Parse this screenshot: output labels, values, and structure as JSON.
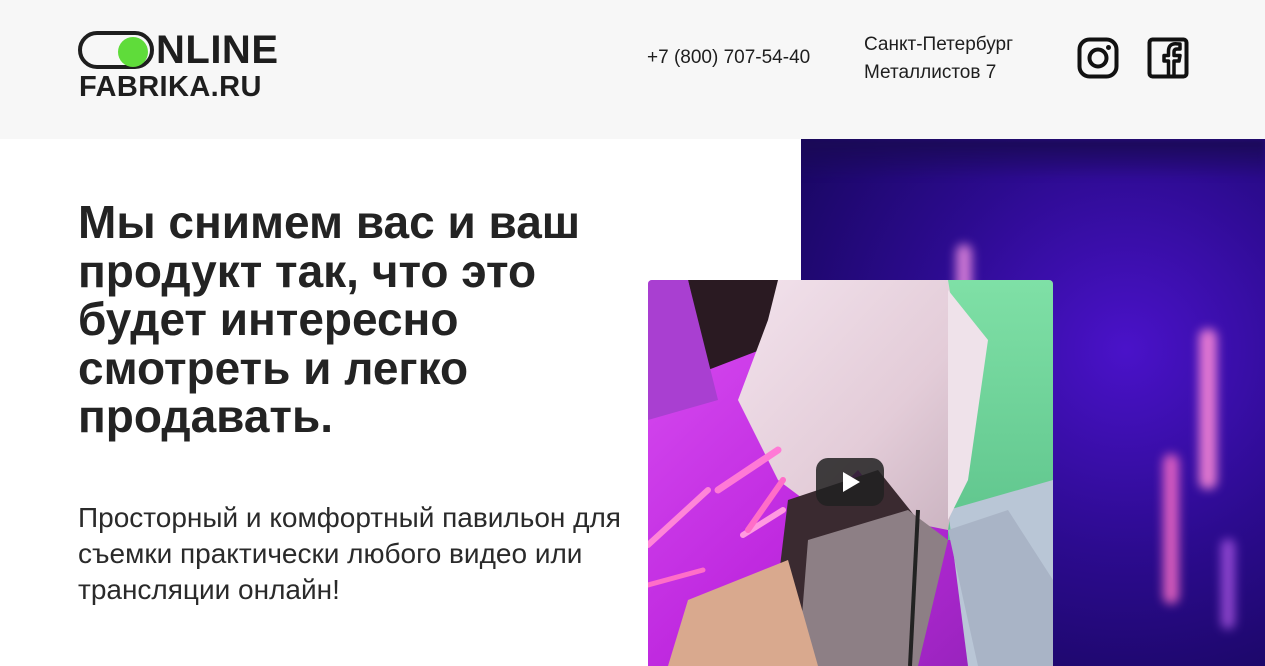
{
  "header": {
    "logo": {
      "line1": "NLINE",
      "line2": "FABRIKA.RU",
      "toggle_color": "#5fdc3a"
    },
    "phone": "+7 (800) 707-54-40",
    "address": {
      "city": "Санкт-Петербург",
      "street": "Металлистов 7"
    },
    "social": [
      {
        "icon": "instagram-icon"
      },
      {
        "icon": "facebook-icon"
      }
    ]
  },
  "hero": {
    "title": "Мы снимем вас и ваш продукт так, что это будет интересно смотреть и легко продавать.",
    "subtitle": "Просторный и комфортный павильон для съемки практически любого видео или трансляции онлайн!"
  },
  "video": {
    "play_icon": "play-icon"
  },
  "colors": {
    "header_bg": "#f7f7f7",
    "text": "#232323",
    "accent_green": "#5fdc3a",
    "bg_purple": "#2c0b8f"
  }
}
